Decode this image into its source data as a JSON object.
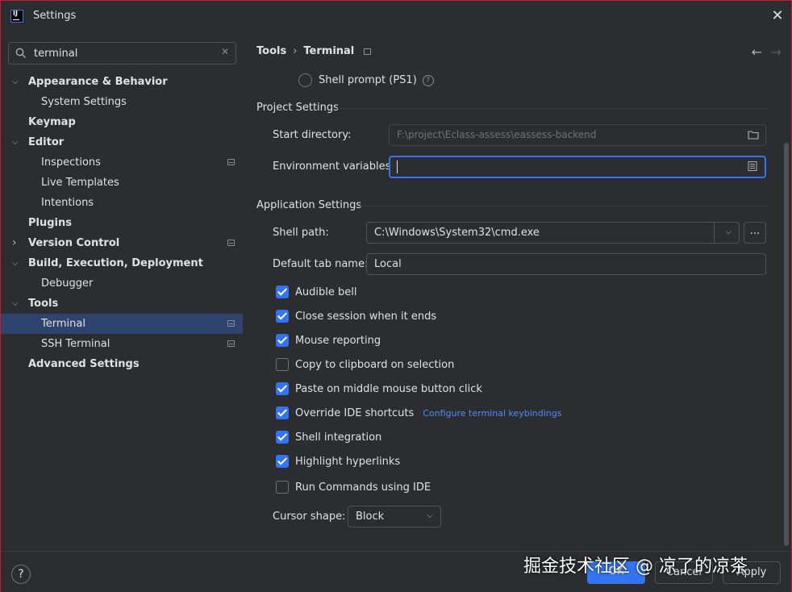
{
  "window": {
    "title": "Settings",
    "logo_text": "IJ"
  },
  "search": {
    "value": "terminal"
  },
  "sidebar": {
    "items": [
      {
        "label": "Appearance & Behavior",
        "bold": true,
        "arrow": "expanded",
        "level": 0,
        "badge": false,
        "selected": false
      },
      {
        "label": "System Settings",
        "bold": false,
        "arrow": "none",
        "level": 1,
        "badge": false,
        "selected": false
      },
      {
        "label": "Keymap",
        "bold": true,
        "arrow": "none",
        "level": 0,
        "badge": false,
        "selected": false
      },
      {
        "label": "Editor",
        "bold": true,
        "arrow": "expanded",
        "level": 0,
        "badge": false,
        "selected": false
      },
      {
        "label": "Inspections",
        "bold": false,
        "arrow": "none",
        "level": 1,
        "badge": true,
        "selected": false
      },
      {
        "label": "Live Templates",
        "bold": false,
        "arrow": "none",
        "level": 1,
        "badge": false,
        "selected": false
      },
      {
        "label": "Intentions",
        "bold": false,
        "arrow": "none",
        "level": 1,
        "badge": false,
        "selected": false
      },
      {
        "label": "Plugins",
        "bold": true,
        "arrow": "none",
        "level": 0,
        "badge": false,
        "selected": false
      },
      {
        "label": "Version Control",
        "bold": true,
        "arrow": "collapsed",
        "level": 0,
        "badge": true,
        "selected": false
      },
      {
        "label": "Build, Execution, Deployment",
        "bold": true,
        "arrow": "expanded",
        "level": 0,
        "badge": false,
        "selected": false
      },
      {
        "label": "Debugger",
        "bold": false,
        "arrow": "none",
        "level": 1,
        "badge": false,
        "selected": false
      },
      {
        "label": "Tools",
        "bold": true,
        "arrow": "expanded",
        "level": 0,
        "badge": false,
        "selected": false
      },
      {
        "label": "Terminal",
        "bold": false,
        "arrow": "none",
        "level": 1,
        "badge": true,
        "selected": true
      },
      {
        "label": "SSH Terminal",
        "bold": false,
        "arrow": "none",
        "level": 1,
        "badge": true,
        "selected": false
      },
      {
        "label": "Advanced Settings",
        "bold": true,
        "arrow": "none",
        "level": 0,
        "badge": false,
        "selected": false
      }
    ]
  },
  "breadcrumb": {
    "parent": "Tools",
    "separator": "›",
    "current": "Terminal"
  },
  "shell_prompt": {
    "label": "Shell prompt (PS1)",
    "help": "?"
  },
  "project_settings": {
    "title": "Project Settings",
    "start_directory_label": "Start directory:",
    "start_directory_value": "F:\\project\\Eclass-assess\\eassess-backend",
    "env_vars_label": "Environment variables:",
    "env_vars_value": ""
  },
  "application_settings": {
    "title": "Application Settings",
    "shell_path_label": "Shell path:",
    "shell_path_value": "C:\\Windows\\System32\\cmd.exe",
    "shell_path_browse": "...",
    "default_tab_label": "Default tab name:",
    "default_tab_value": "Local"
  },
  "checkboxes": [
    {
      "label": "Audible bell",
      "checked": true
    },
    {
      "label": "Close session when it ends",
      "checked": true
    },
    {
      "label": "Mouse reporting",
      "checked": true
    },
    {
      "label": "Copy to clipboard on selection",
      "checked": false
    },
    {
      "label": "Paste on middle mouse button click",
      "checked": true
    },
    {
      "label": "Override IDE shortcuts",
      "checked": true,
      "link": "Configure terminal keybindings"
    },
    {
      "label": "Shell integration",
      "checked": true
    },
    {
      "label": "Highlight hyperlinks",
      "checked": true
    },
    {
      "label": "Run Commands using IDE",
      "checked": false
    }
  ],
  "cursor_shape": {
    "label": "Cursor shape:",
    "value": "Block"
  },
  "footer": {
    "help": "?",
    "ok": "OK",
    "cancel": "Cancel",
    "apply": "Apply"
  },
  "watermark": "掘金技术社区 @ 凉了的凉茶",
  "colors": {
    "accent": "#3574f0",
    "background": "#2b2d30",
    "selection": "#2e436e",
    "link": "#548af7",
    "window_border": "#c21d2e"
  }
}
